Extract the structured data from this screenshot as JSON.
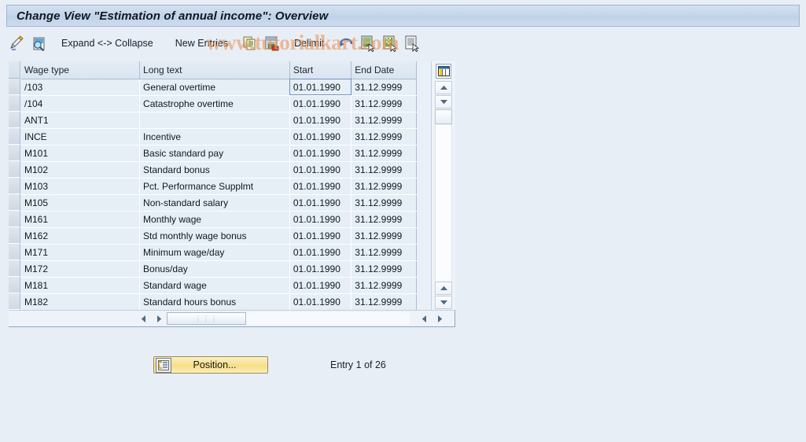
{
  "window": {
    "title": "Change View \"Estimation of annual income\": Overview"
  },
  "watermark": {
    "text": "www.tutorialkart.com"
  },
  "toolbar": {
    "icons_left": [
      {
        "name": "display-change-pencil-icon"
      },
      {
        "name": "display-details-magnifier-icon"
      }
    ],
    "expand_collapse_label": "Expand <-> Collapse",
    "new_entries_label": "New Entries",
    "copy_icon": "copy-as-icon",
    "paste_icon": "paste-icon",
    "delimit_label": "Delimit",
    "undo_icon": "undo-icon",
    "prev_entry_icon": "previous-entry-icon",
    "next_entry_icon": "next-entry-icon",
    "other_entry_icon": "other-entry-icon"
  },
  "table": {
    "columns": [
      "Wage type",
      "Long text",
      "Start",
      "End Date"
    ],
    "rows": [
      {
        "wage_type": "/103",
        "long_text": "General overtime",
        "start": "01.01.1990",
        "end": "31.12.9999",
        "selected_cell": "start"
      },
      {
        "wage_type": "/104",
        "long_text": "Catastrophe overtime",
        "start": "01.01.1990",
        "end": "31.12.9999"
      },
      {
        "wage_type": "ANT1",
        "long_text": "",
        "start": "01.01.1990",
        "end": "31.12.9999"
      },
      {
        "wage_type": "INCE",
        "long_text": "Incentive",
        "start": "01.01.1990",
        "end": "31.12.9999"
      },
      {
        "wage_type": "M101",
        "long_text": "Basic standard pay",
        "start": "01.01.1990",
        "end": "31.12.9999"
      },
      {
        "wage_type": "M102",
        "long_text": "Standard bonus",
        "start": "01.01.1990",
        "end": "31.12.9999"
      },
      {
        "wage_type": "M103",
        "long_text": "Pct. Performance Supplmt",
        "start": "01.01.1990",
        "end": "31.12.9999"
      },
      {
        "wage_type": "M105",
        "long_text": "Non-standard salary",
        "start": "01.01.1990",
        "end": "31.12.9999"
      },
      {
        "wage_type": "M161",
        "long_text": "Monthly wage",
        "start": "01.01.1990",
        "end": "31.12.9999"
      },
      {
        "wage_type": "M162",
        "long_text": "Std monthly wage bonus",
        "start": "01.01.1990",
        "end": "31.12.9999"
      },
      {
        "wage_type": "M171",
        "long_text": "Minimum wage/day",
        "start": "01.01.1990",
        "end": "31.12.9999"
      },
      {
        "wage_type": "M172",
        "long_text": "Bonus/day",
        "start": "01.01.1990",
        "end": "31.12.9999"
      },
      {
        "wage_type": "M181",
        "long_text": "Standard wage",
        "start": "01.01.1990",
        "end": "31.12.9999"
      },
      {
        "wage_type": "M182",
        "long_text": "Standard hours bonus",
        "start": "01.01.1990",
        "end": "31.12.9999"
      }
    ],
    "config_icon": "table-settings-icon"
  },
  "footer": {
    "position_button_label": "Position...",
    "position_button_icon": "position-icon",
    "entry_status": "Entry 1 of 26"
  },
  "colors": {
    "page_background": "#e8eef6",
    "title_bar": "#c5d6eb",
    "grid_cell": "#e6eef6",
    "date_cell": "#ffffff",
    "selected_cell": "#c3d6ea",
    "button_yellow": "#f7e08f",
    "watermark": "#e6965a"
  }
}
